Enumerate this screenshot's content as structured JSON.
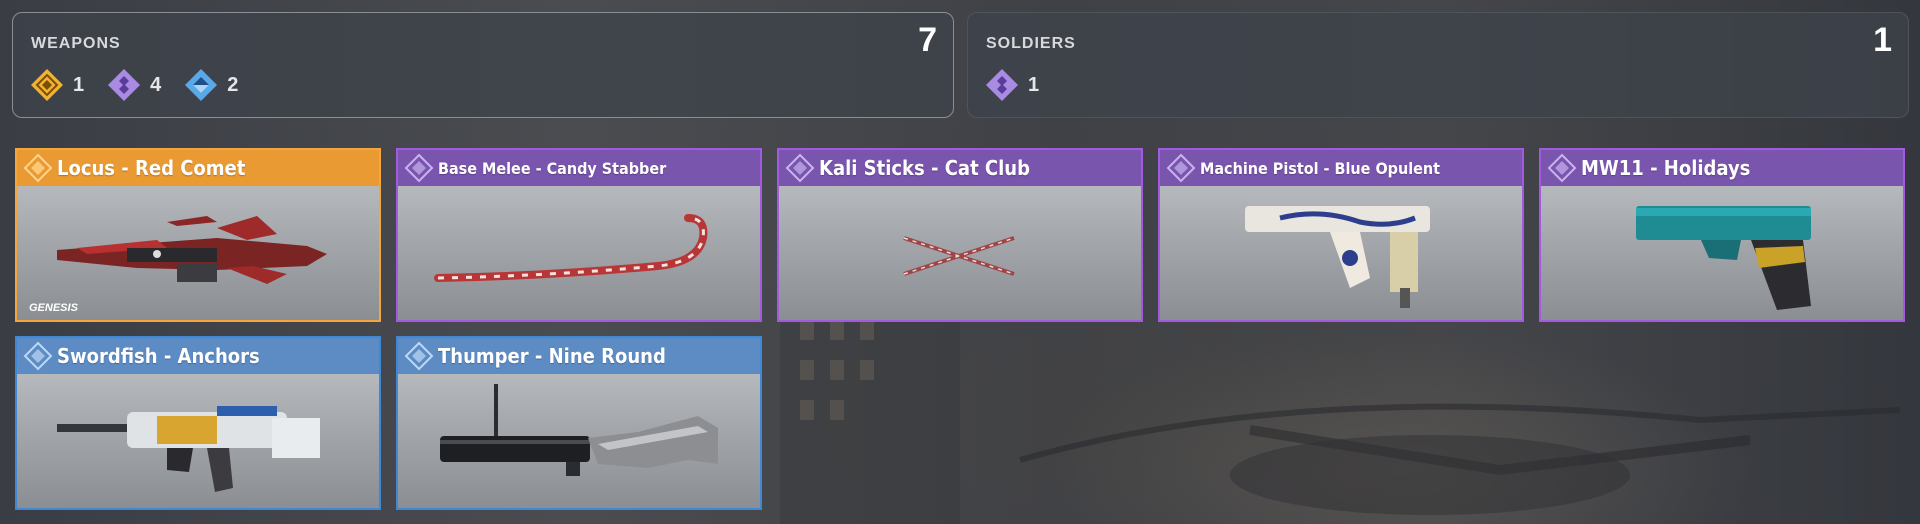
{
  "summary": {
    "weapons": {
      "title": "WEAPONS",
      "total": "7",
      "rarities": [
        {
          "icon": "orange-diamond-icon",
          "color": "#f2b232",
          "count": "1"
        },
        {
          "icon": "purple-diamond-icon",
          "color": "#a98be3",
          "count": "4"
        },
        {
          "icon": "blue-diamond-icon",
          "color": "#59a9e8",
          "count": "2"
        }
      ]
    },
    "soldiers": {
      "title": "SOLDIERS",
      "total": "1",
      "rarities": [
        {
          "icon": "purple-diamond-icon",
          "color": "#a98be3",
          "count": "1"
        }
      ]
    }
  },
  "cards": [
    {
      "name": "Locus - Red Comet",
      "rarity": "orange",
      "logo": "GENESIS"
    },
    {
      "name": "Base Melee - Candy Stabber",
      "rarity": "purple"
    },
    {
      "name": "Kali Sticks - Cat Club",
      "rarity": "purple"
    },
    {
      "name": "Machine Pistol - Blue Opulent",
      "rarity": "purple"
    },
    {
      "name": "MW11 - Holidays",
      "rarity": "purple"
    },
    {
      "name": "Swordfish - Anchors",
      "rarity": "blue"
    },
    {
      "name": "Thumper - Nine Round",
      "rarity": "blue"
    }
  ],
  "colors": {
    "orange": "#e99a32",
    "purple": "#7a55ad",
    "blue": "#5d8cc4"
  }
}
